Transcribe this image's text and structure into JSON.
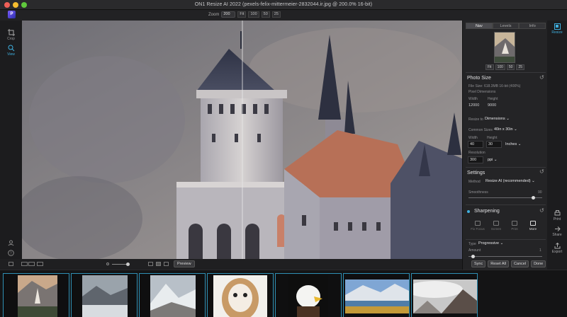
{
  "window": {
    "title": "ON1 Resize AI 2022 (pexels-felix-mittermeier-2832044.ir.jpg @ 200.0% 16-bit)"
  },
  "toolbar": {
    "logo_text": "P",
    "zoom_label": "Zoom",
    "zoom_value": "200",
    "zoom_presets": [
      "Fit",
      "100",
      "50",
      "25"
    ]
  },
  "left_tools": [
    {
      "label": "Crop",
      "icon": "crop-icon"
    },
    {
      "label": "View",
      "icon": "view-icon"
    }
  ],
  "panel": {
    "tabs": [
      "Nav",
      "Levels",
      "Info"
    ],
    "active_tab": "Nav",
    "nav_buttons": [
      "Fit",
      "100",
      "50",
      "25"
    ],
    "photo_size": {
      "title": "Photo Size",
      "file_size": "File Size:  618.3MB 16-bit (400%)",
      "pixel_dimensions_label": "Pixel Dimensions",
      "width_label": "Width",
      "height_label": "Height",
      "width_px": "12000",
      "height_px": "9000",
      "resize_to_label": "Resize to",
      "resize_to_value": "Dimensions",
      "common_sizes_label": "Common Sizes",
      "common_sizes_value": "40in x 30in",
      "doc_width_label": "Width",
      "doc_height_label": "Height",
      "doc_width": "40",
      "doc_height": "30",
      "unit": "Inches",
      "resolution_label": "Resolution",
      "resolution": "300",
      "resolution_unit": "ppi"
    },
    "settings": {
      "title": "Settings",
      "method_label": "Method",
      "method_value": "Resize AI (recommended)",
      "smoothness_label": "Smoothness",
      "smoothness_value": "90"
    },
    "sharpening": {
      "title": "Sharpening",
      "options": [
        "Fix Focus",
        "Screen",
        "Print",
        "More"
      ],
      "selected": "More",
      "type_label": "Type",
      "type_value": "Progressive",
      "amount_label": "Amount",
      "amount_value": "1"
    },
    "actions": [
      "Sync",
      "Reset All",
      "Cancel",
      "Done"
    ]
  },
  "right_tools": [
    {
      "label": "Resize",
      "icon": "resize-icon"
    },
    {
      "label": "Print",
      "icon": "print-icon"
    },
    {
      "label": "Share",
      "icon": "share-icon"
    },
    {
      "label": "Export",
      "icon": "export-icon"
    }
  ],
  "statusbar": {
    "preview_label": "Preview"
  },
  "filmstrip": {
    "thumbnails": [
      "castle",
      "snow-valley",
      "snow-mountains",
      "owl",
      "eagle",
      "lake-mountains",
      "cloud-mountains"
    ]
  }
}
